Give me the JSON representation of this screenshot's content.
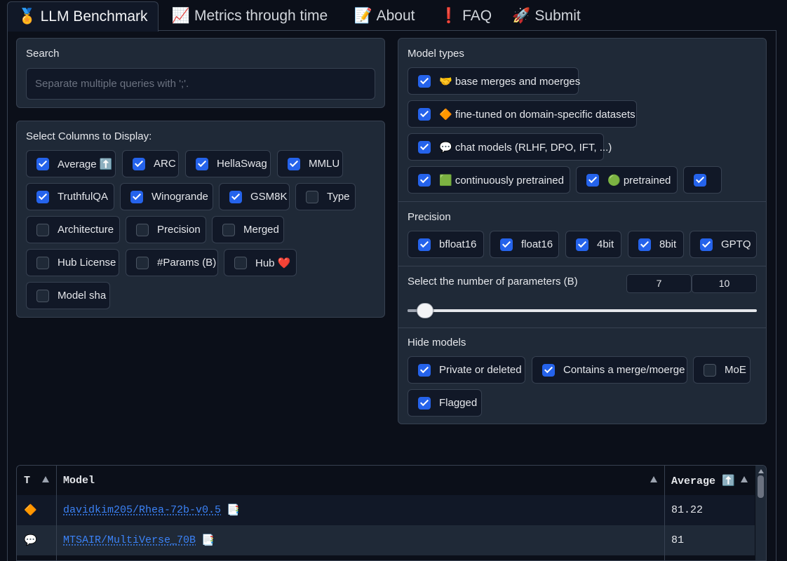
{
  "tabs": [
    {
      "icon": "🏅",
      "label": "LLM Benchmark",
      "active": true
    },
    {
      "icon": "📈",
      "label": "Metrics through time"
    },
    {
      "icon": "📝",
      "label": "About"
    },
    {
      "icon": "❗",
      "label": "FAQ"
    },
    {
      "icon": "🚀",
      "label": "Submit"
    }
  ],
  "search": {
    "label": "Search",
    "placeholder": "Separate multiple queries with ';'."
  },
  "columns": {
    "label": "Select Columns to Display:",
    "items": [
      {
        "label": "Average ⬆️",
        "checked": true
      },
      {
        "label": "ARC",
        "checked": true
      },
      {
        "label": "HellaSwag",
        "checked": true
      },
      {
        "label": "MMLU",
        "checked": true
      },
      {
        "label": "TruthfulQA",
        "checked": true
      },
      {
        "label": "Winogrande",
        "checked": true
      },
      {
        "label": "GSM8K",
        "checked": true
      },
      {
        "label": "Type",
        "checked": false
      },
      {
        "label": "Architecture",
        "checked": false
      },
      {
        "label": "Precision",
        "checked": false
      },
      {
        "label": "Merged",
        "checked": false
      },
      {
        "label": "Hub License",
        "checked": false
      },
      {
        "label": "#Params (B)",
        "checked": false
      },
      {
        "label": "Hub ❤️",
        "checked": false
      },
      {
        "label": "Model sha",
        "checked": false
      }
    ]
  },
  "model_types": {
    "label": "Model types",
    "items": [
      {
        "label": "🤝 base merges and moerges",
        "checked": true
      },
      {
        "label": "🔶 fine-tuned on domain-specific datasets",
        "checked": true
      },
      {
        "label": "💬 chat models (RLHF, DPO, IFT, ...)",
        "checked": true
      },
      {
        "label": "🟩 continuously pretrained",
        "checked": true
      },
      {
        "label": "🟢 pretrained",
        "checked": true
      },
      {
        "label": "",
        "checked": true
      }
    ]
  },
  "precision": {
    "label": "Precision",
    "items": [
      {
        "label": "bfloat16",
        "checked": true
      },
      {
        "label": "float16",
        "checked": true
      },
      {
        "label": "4bit",
        "checked": true
      },
      {
        "label": "8bit",
        "checked": true
      },
      {
        "label": "GPTQ",
        "checked": true
      }
    ]
  },
  "params": {
    "label": "Select the number of parameters (B)",
    "min_value": "7",
    "max_value": "10",
    "slider_fraction": 0.05
  },
  "hide_models": {
    "label": "Hide models",
    "items": [
      {
        "label": "Private or deleted",
        "checked": true
      },
      {
        "label": "Contains a merge/moerge",
        "checked": true
      },
      {
        "label": "MoE",
        "checked": false
      },
      {
        "label": "Flagged",
        "checked": true
      }
    ]
  },
  "table": {
    "headers": {
      "type": "T",
      "model": "Model",
      "average": "Average ⬆️"
    },
    "rows": [
      {
        "type": "🔶",
        "model": "davidkim205/Rhea-72b-v0.5",
        "model_icon": "📑",
        "average": "81.22"
      },
      {
        "type": "💬",
        "model": "MTSAIR/MultiVerse_70B",
        "model_icon": "📑",
        "average": "81"
      }
    ]
  },
  "colors": {
    "accent": "#2563eb",
    "link": "#3b82f6",
    "panel": "#1f2937",
    "background": "#0b0f19"
  }
}
